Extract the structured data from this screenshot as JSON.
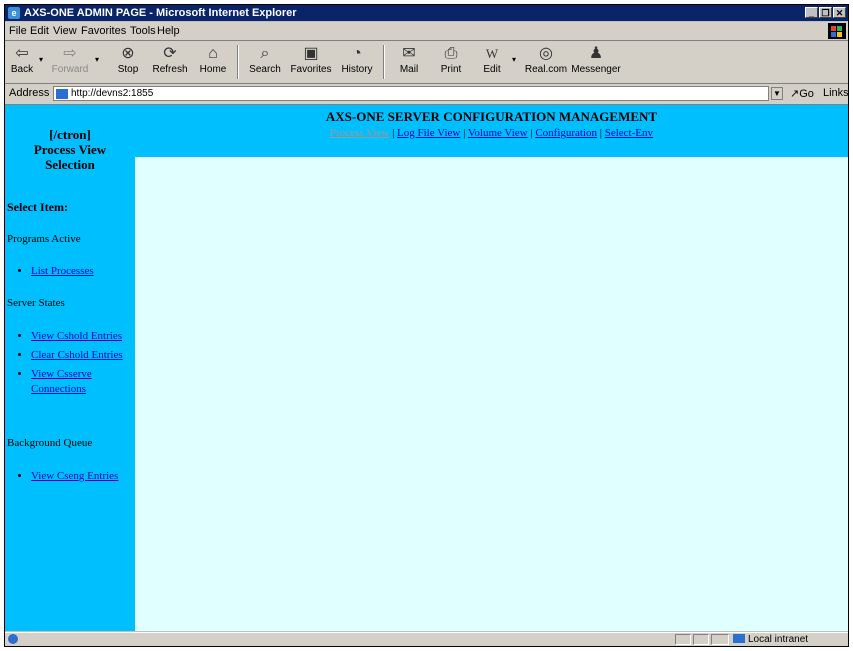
{
  "window": {
    "title": "AXS-ONE ADMIN PAGE - Microsoft Internet Explorer",
    "min_glyph": "_",
    "max_glyph": "❐",
    "close_glyph": "✕"
  },
  "menu": [
    "File",
    "Edit",
    "View",
    "Favorites",
    "Tools",
    "Help"
  ],
  "toolbar": {
    "back": "Back",
    "forward": "Forward",
    "stop": "Stop",
    "refresh": "Refresh",
    "home": "Home",
    "search": "Search",
    "favorites": "Favorites",
    "history": "History",
    "mail": "Mail",
    "print": "Print",
    "edit": "Edit",
    "realcom": "Real.com",
    "messenger": "Messenger"
  },
  "address": {
    "label": "Address",
    "url": "http://devns2:1855",
    "go": "Go",
    "links": "Links"
  },
  "sidebar": {
    "context": "[/ctron]",
    "heading_line1": "Process View",
    "heading_line2": "Selection",
    "select_item": "Select Item:",
    "groups": [
      {
        "title": "Programs Active",
        "items": [
          "List Processes"
        ]
      },
      {
        "title": "Server States",
        "items": [
          "View Cshold Entries",
          "Clear Cshold Entries",
          "View Csserve Connections"
        ]
      },
      {
        "title": "Background Queue",
        "items": [
          "View Cseng Entries"
        ]
      }
    ]
  },
  "main": {
    "title": "AXS-ONE SERVER CONFIGURATION MANAGEMENT",
    "tabs": [
      "Process View",
      "Log File View",
      "Volume View",
      "Configuration",
      "Select-Env"
    ],
    "tab_separator": "|"
  },
  "status": {
    "zone": "Local intranet"
  },
  "colors": {
    "sidebar_bg": "#00bfff",
    "content_bg": "#e0ffff",
    "link": "#0000cc",
    "title_bar": "#0a246a"
  }
}
